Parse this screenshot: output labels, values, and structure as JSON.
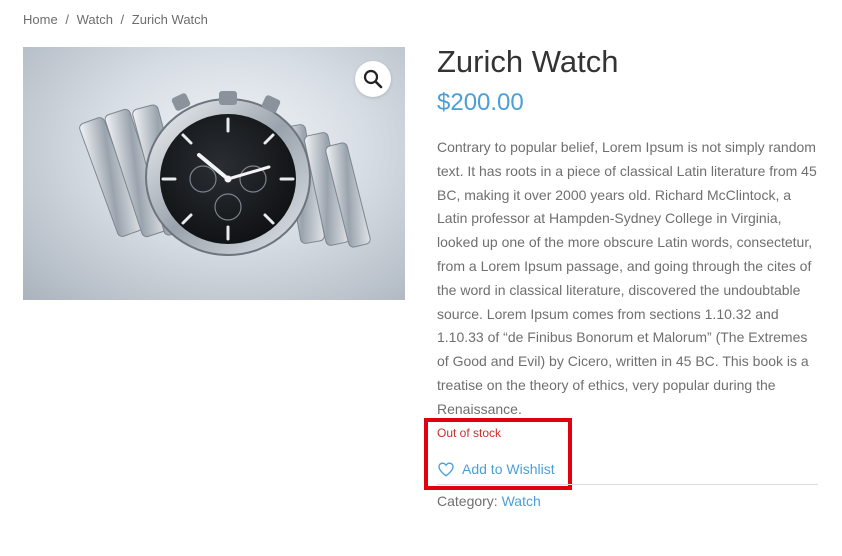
{
  "breadcrumb": {
    "home": "Home",
    "category": "Watch",
    "current": "Zurich Watch",
    "separator": "/"
  },
  "product": {
    "title": "Zurich Watch",
    "price": "$200.00",
    "description": "Contrary to popular belief, Lorem Ipsum is not simply random text. It has roots in a piece of classical Latin literature from 45 BC, making it over 2000 years old. Richard McClintock, a Latin professor at Hampden-Sydney College in Virginia, looked up one of the more obscure Latin words, consectetur, from a Lorem Ipsum passage, and going through the cites of the word in classical literature, discovered the undoubtable source. Lorem Ipsum comes from sections 1.10.32 and 1.10.33 of “de Finibus Bonorum et Malorum” (The Extremes of Good and Evil) by Cicero, written in 45 BC. This book is a treatise on the theory of ethics, very popular during the Renaissance.",
    "stock_status": "Out of stock",
    "wishlist_label": "Add to Wishlist",
    "category_label": "Category:",
    "category_value": "Watch"
  },
  "icons": {
    "zoom": "magnifier-icon",
    "wishlist": "heart-icon"
  },
  "colors": {
    "accent": "#4b9fd8",
    "stock": "#c9302c",
    "highlight": "#e1000f"
  }
}
